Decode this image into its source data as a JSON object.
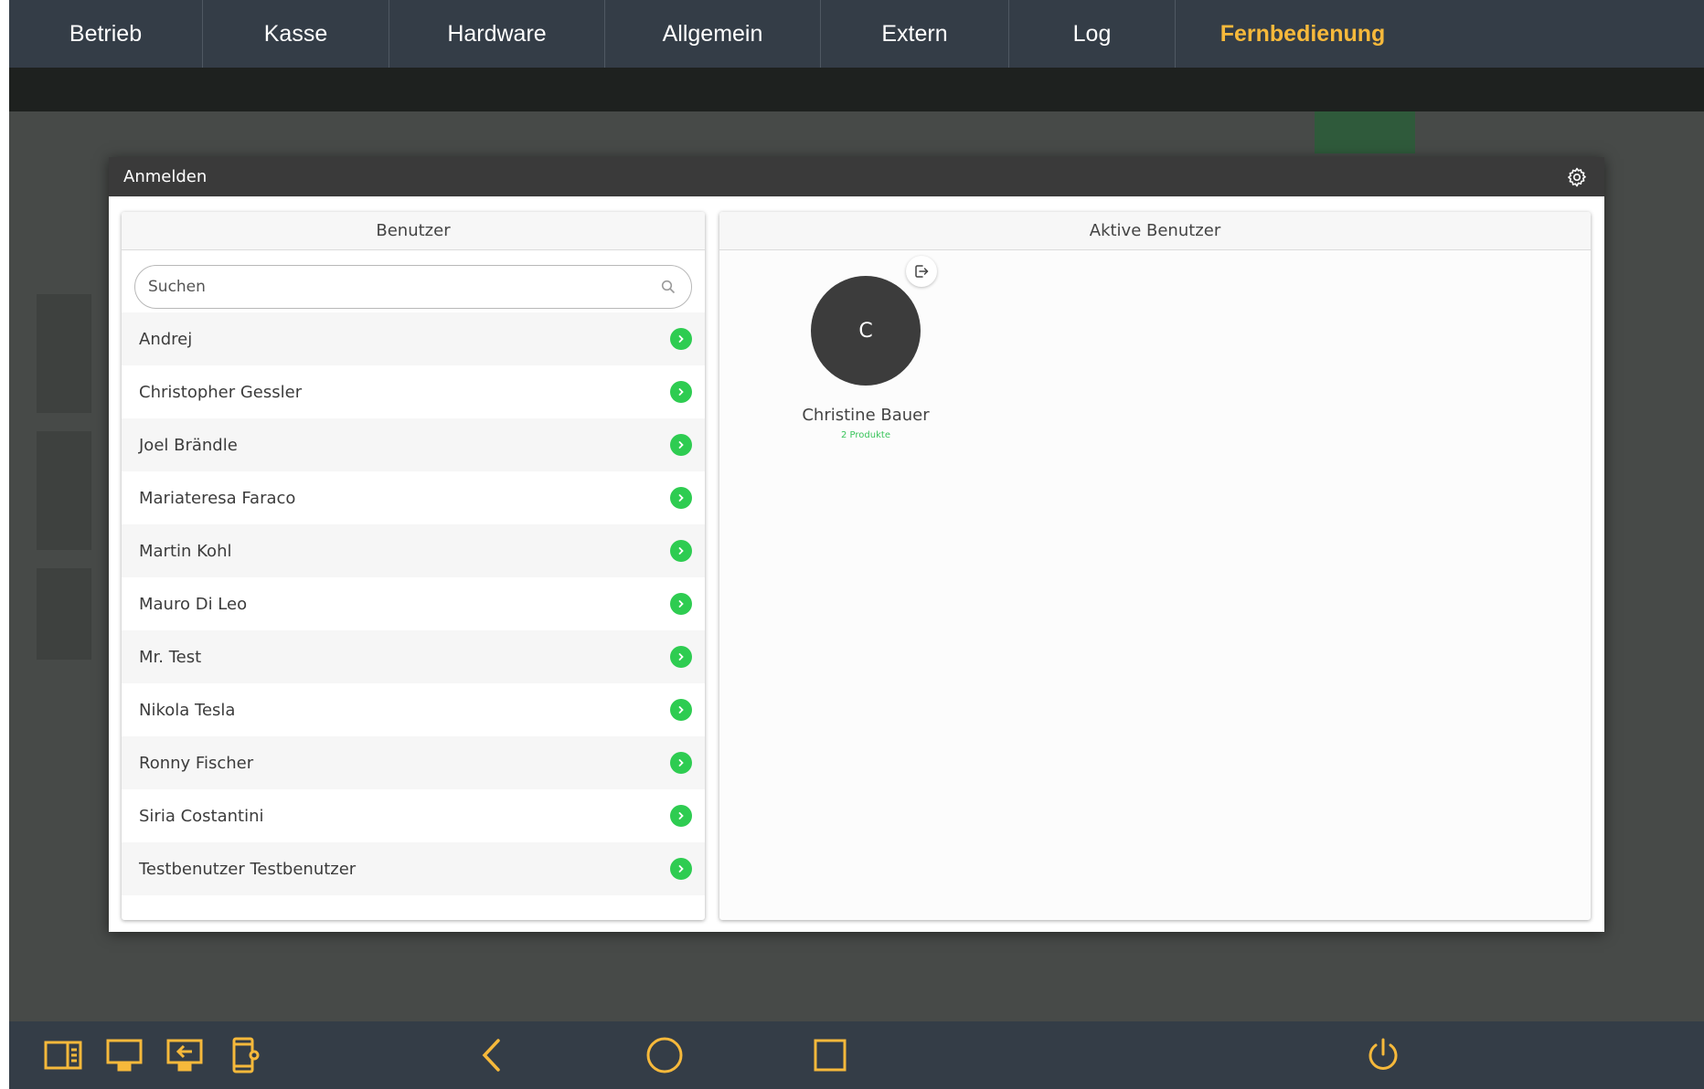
{
  "topbar": {
    "tabs": [
      {
        "label": "Betrieb",
        "active": false
      },
      {
        "label": "Kasse",
        "active": false
      },
      {
        "label": "Hardware",
        "active": false
      },
      {
        "label": "Allgemein",
        "active": false
      },
      {
        "label": "Extern",
        "active": false
      },
      {
        "label": "Log",
        "active": false
      },
      {
        "label": "Fernbedienung",
        "active": true
      }
    ]
  },
  "colors": {
    "bar_bg": "#343d47",
    "active_tab": "#f6b93b",
    "accent_green": "#2ecc51",
    "nav_icon": "#f6b93b",
    "modal_header": "#3a3a3a"
  },
  "modal": {
    "title": "Anmelden",
    "settings_icon": "gear-icon",
    "users_panel": {
      "heading": "Benutzer",
      "search_placeholder": "Suchen",
      "search_value": "",
      "users": [
        "Andrej",
        "Christopher Gessler",
        "Joel Brändle",
        "Mariateresa Faraco",
        "Martin Kohl",
        "Mauro Di Leo",
        "Mr. Test",
        "Nikola Tesla",
        "Ronny Fischer",
        "Siria Costantini",
        "Testbenutzer Testbenutzer"
      ]
    },
    "active_panel": {
      "heading": "Aktive Benutzer",
      "active_users": [
        {
          "initial": "C",
          "name": "Christine Bauer",
          "products": "2 Produkte"
        }
      ]
    }
  },
  "navbar": {
    "icons": [
      "sidebar-layout-icon",
      "monitor-icon",
      "screen-switch-icon",
      "device-settings-icon",
      "back-icon",
      "home-icon",
      "recents-icon",
      "power-icon"
    ]
  }
}
